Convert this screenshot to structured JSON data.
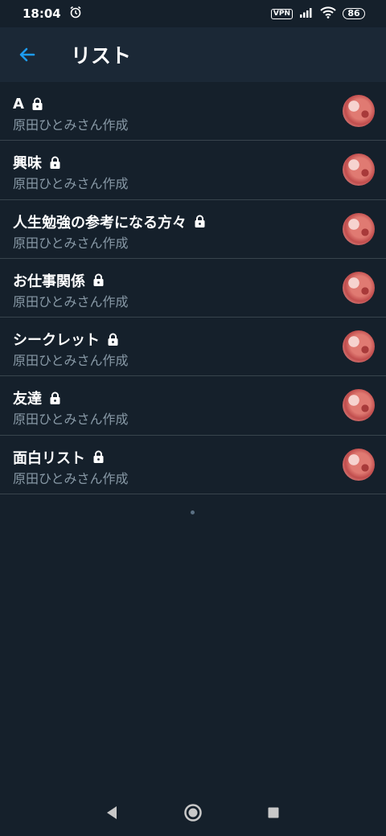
{
  "status_bar": {
    "time": "18:04",
    "vpn": "VPN",
    "battery": "86",
    "icons": [
      "alarm-icon",
      "signal-icon",
      "wifi-icon",
      "battery-icon"
    ]
  },
  "header": {
    "title": "リスト",
    "back_icon": "back-arrow-icon",
    "accent_color": "#1d9bf0"
  },
  "lists": [
    {
      "name": "A",
      "creator": "原田ひとみさん作成",
      "locked": true
    },
    {
      "name": "興味",
      "creator": "原田ひとみさん作成",
      "locked": true
    },
    {
      "name": "人生勉強の参考になる方々",
      "creator": "原田ひとみさん作成",
      "locked": true
    },
    {
      "name": "お仕事関係",
      "creator": "原田ひとみさん作成",
      "locked": true
    },
    {
      "name": "シークレット",
      "creator": "原田ひとみさん作成",
      "locked": true
    },
    {
      "name": "友達",
      "creator": "原田ひとみさん作成",
      "locked": true
    },
    {
      "name": "面白リスト",
      "creator": "原田ひとみさん作成",
      "locked": true
    }
  ],
  "nav": {
    "icons": [
      "back-triangle-icon",
      "home-circle-icon",
      "recents-square-icon"
    ]
  },
  "colors": {
    "background": "#15202b",
    "header_bg": "#1b2836",
    "secondary_text": "#8899a6",
    "divider": "#38444d"
  }
}
